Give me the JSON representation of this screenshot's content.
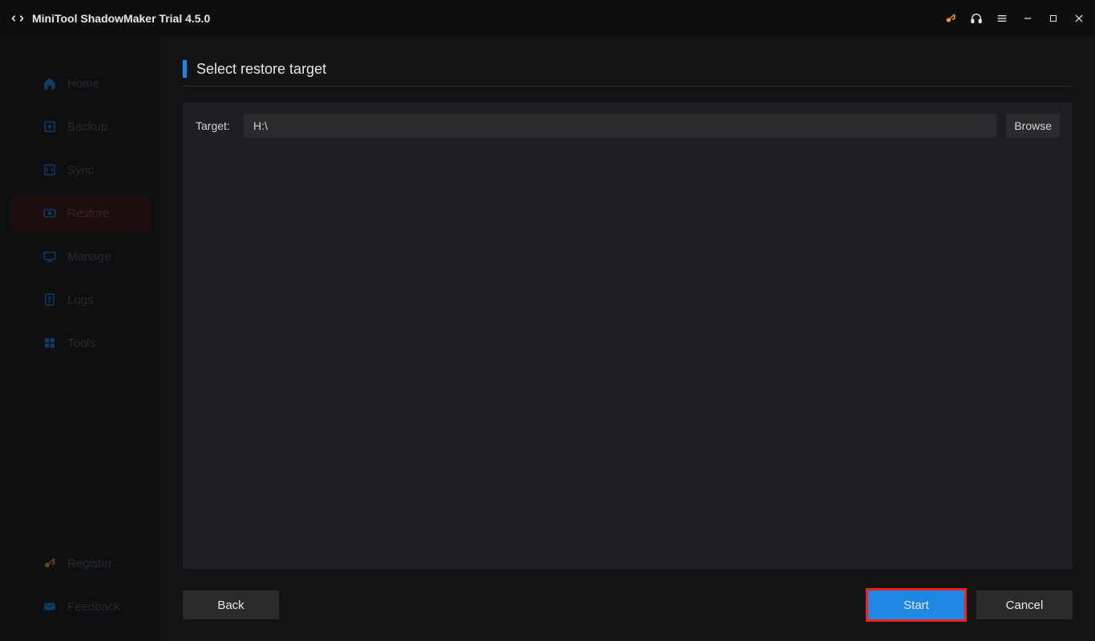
{
  "title": "MiniTool ShadowMaker Trial 4.5.0",
  "nav": [
    {
      "label": "Home"
    },
    {
      "label": "Backup"
    },
    {
      "label": "Sync"
    },
    {
      "label": "Restore"
    },
    {
      "label": "Manage"
    },
    {
      "label": "Logs"
    },
    {
      "label": "Tools"
    }
  ],
  "bottomNav": [
    {
      "label": "Register"
    },
    {
      "label": "Feedback"
    }
  ],
  "heading": "Select restore target",
  "target": {
    "label": "Target:",
    "value": "H:\\",
    "browse": "Browse"
  },
  "buttons": {
    "back": "Back",
    "start": "Start",
    "cancel": "Cancel"
  }
}
